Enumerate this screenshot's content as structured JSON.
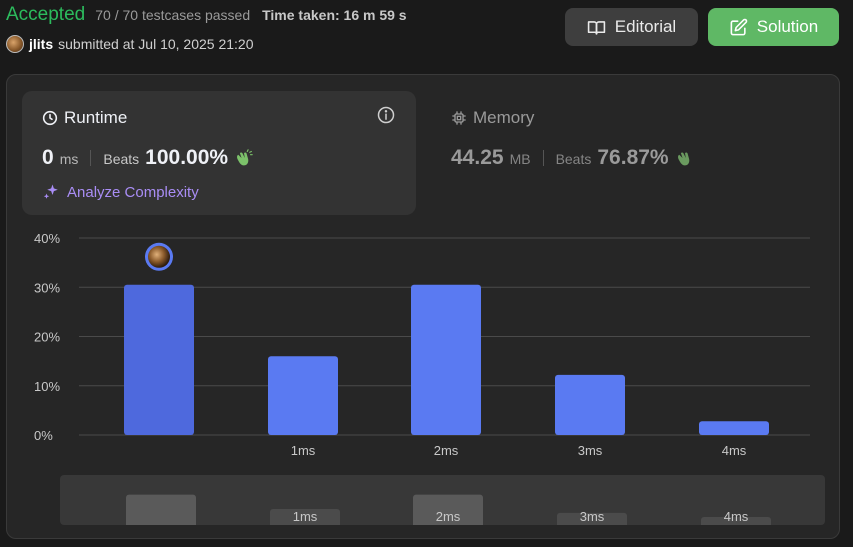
{
  "header": {
    "status": "Accepted",
    "testcases": "70 / 70 testcases passed",
    "time_taken": "Time taken: 16 m 59 s",
    "username": "jlits",
    "submitted_at": "submitted at Jul 10, 2025 21:20"
  },
  "buttons": {
    "editorial_label": "Editorial",
    "solution_label": "Solution"
  },
  "runtime": {
    "title": "Runtime",
    "value": "0",
    "unit": "ms",
    "beats_label": "Beats",
    "beats_value": "100.00%",
    "analyze_label": "Analyze Complexity"
  },
  "memory": {
    "title": "Memory",
    "value": "44.25",
    "unit": "MB",
    "beats_label": "Beats",
    "beats_value": "76.87%"
  },
  "colors": {
    "accepted": "#2cbb5d",
    "bar": "#5a7af2",
    "bar_selected": "#4e69dd",
    "analyze": "#a98df5",
    "solution_button": "#5fb865"
  },
  "icons": [
    "book-icon",
    "edit-icon",
    "clock-icon",
    "info-icon",
    "chip-icon",
    "clapping-hands-icon",
    "sparkle-icon",
    "avatar"
  ],
  "chart_data": {
    "type": "bar",
    "x_labels": [
      "",
      "1ms",
      "2ms",
      "3ms",
      "4ms"
    ],
    "values": [
      30.5,
      16.0,
      30.5,
      12.2,
      2.8
    ],
    "y_ticks": [
      "40%",
      "30%",
      "20%",
      "10%",
      "0%"
    ],
    "ylim": [
      0,
      40
    ],
    "selected_index": 0,
    "grid": true,
    "overview_x_labels": [
      "",
      "1ms",
      "2ms",
      "3ms",
      "4ms"
    ]
  }
}
